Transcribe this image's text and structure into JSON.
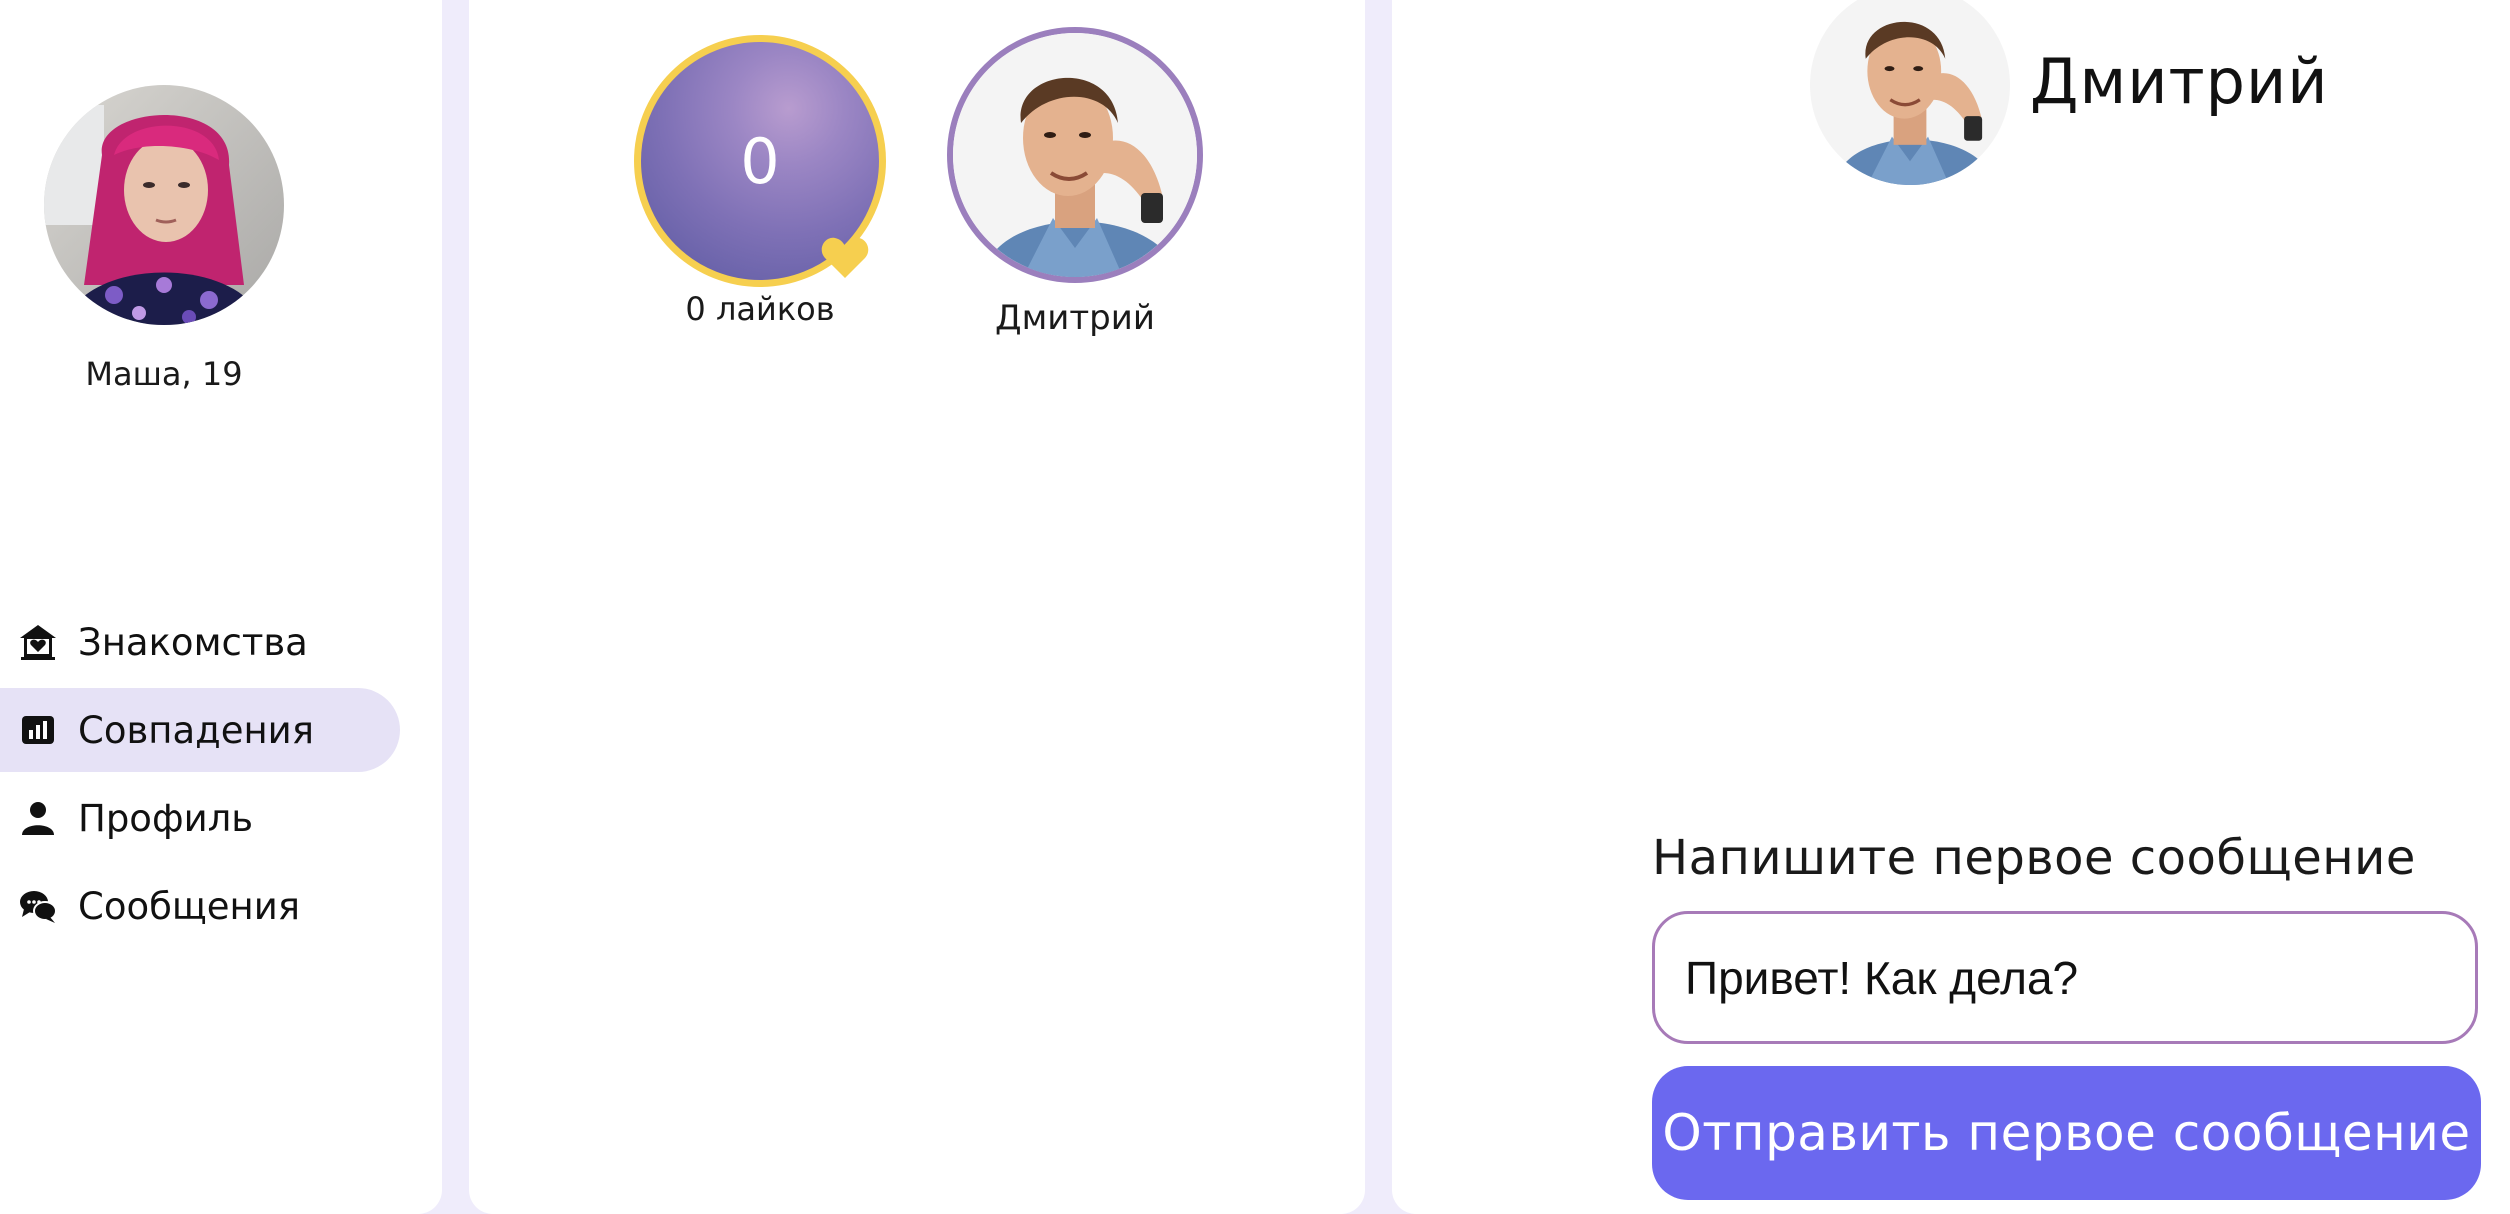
{
  "user": {
    "name_age": "Маша, 19"
  },
  "nav": {
    "items": [
      {
        "label": "Знакомства",
        "icon": "home-heart-icon"
      },
      {
        "label": "Совпадения",
        "icon": "chart-icon",
        "active": true
      },
      {
        "label": "Профиль",
        "icon": "person-icon"
      },
      {
        "label": "Сообщения",
        "icon": "chat-bubbles-icon"
      }
    ]
  },
  "matches": {
    "likes_count": "0",
    "likes_label": "0 лайков",
    "items": [
      {
        "name": "Дмитрий"
      }
    ]
  },
  "chat": {
    "partner_name": "Дмитрий",
    "prompt": "Напишите первое сообщение",
    "input_value": "Привет! Как дела?",
    "send_label": "Отправить первое сообщение"
  },
  "colors": {
    "accent": "#6b68ef",
    "active_nav_bg": "#e6e2f6",
    "likes_ring": "#f6cf4f",
    "avatar_ring": "#9b7fbd",
    "background": "#efecfb"
  }
}
